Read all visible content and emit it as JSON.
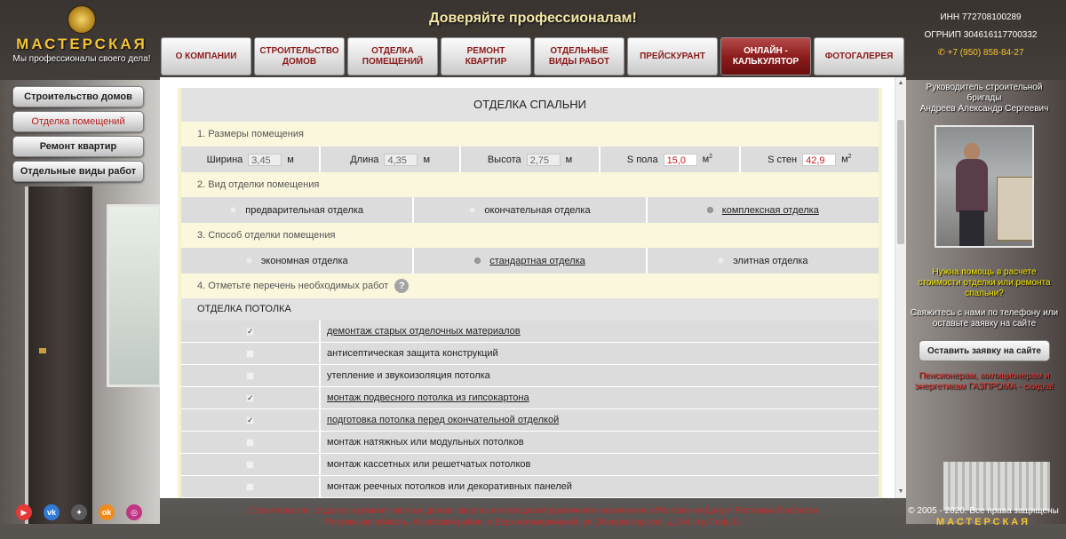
{
  "header": {
    "logo_title": "МАСТЕРСКАЯ",
    "logo_subtitle": "Мы профессионалы своего дела!",
    "slogan": "Доверяйте профессионалам!",
    "inn": "ИНН 772708100289",
    "ogrnip": "ОГРНИП 304616117700332",
    "phone": "+7 (950) 858-84-27",
    "phone_icon": "phone-icon"
  },
  "nav": {
    "items": [
      {
        "label": "О КОМПАНИИ",
        "active": false
      },
      {
        "label": "СТРОИТЕЛЬСТВО\nДОМОВ",
        "active": false
      },
      {
        "label": "ОТДЕЛКА\nПОМЕЩЕНИЙ",
        "active": false
      },
      {
        "label": "РЕМОНТ\nКВАРТИР",
        "active": false
      },
      {
        "label": "ОТДЕЛЬНЫЕ\nВИДЫ РАБОТ",
        "active": false
      },
      {
        "label": "ПРЕЙСКУРАНТ",
        "active": false
      },
      {
        "label": "ОНЛАЙН -\nКАЛЬКУЛЯТОР",
        "active": true
      },
      {
        "label": "ФОТОГАЛЕРЕЯ",
        "active": false
      }
    ]
  },
  "sidebar": {
    "items": [
      {
        "label": "Строительство домов",
        "active": false
      },
      {
        "label": "Отделка помещений",
        "active": true
      },
      {
        "label": "Ремонт квартир",
        "active": false
      },
      {
        "label": "Отдельные виды работ",
        "active": false
      }
    ]
  },
  "calc": {
    "title": "ОТДЕЛКА СПАЛЬНИ",
    "section1": "1. Размеры помещения",
    "dims": {
      "width_label": "Ширина",
      "width_value": "3,45",
      "width_unit": "м",
      "length_label": "Длина",
      "length_value": "4,35",
      "length_unit": "м",
      "height_label": "Высота",
      "height_value": "2,75",
      "height_unit": "м",
      "floor_label": "S пола",
      "floor_value": "15,0",
      "floor_unit": "м",
      "walls_label": "S стен",
      "walls_value": "42,9",
      "walls_unit": "м",
      "sup": "2"
    },
    "section2": "2. Вид отделки помещения",
    "finish_types": [
      {
        "label": "предварительная отделка",
        "selected": false
      },
      {
        "label": "окончательная отделка",
        "selected": false
      },
      {
        "label": "комплексная отделка",
        "selected": true
      }
    ],
    "section3": "3. Способ отделки помещения",
    "finish_methods": [
      {
        "label": "экономная отделка",
        "selected": false
      },
      {
        "label": "стандартная отделка",
        "selected": true
      },
      {
        "label": "элитная отделка",
        "selected": false
      }
    ],
    "section4": "4. Отметьте перечень необходимых работ",
    "help": "?",
    "ceiling_group": "ОТДЕЛКА ПОТОЛКА",
    "check_mark": "✓",
    "works": [
      {
        "label": "демонтаж старых отделочных материалов",
        "checked": true
      },
      {
        "label": "антисептическая защита конструкций",
        "checked": false
      },
      {
        "label": "утепление и звукоизоляция потолка",
        "checked": false
      },
      {
        "label": "монтаж подвесного потолка из гипсокартона",
        "checked": true
      },
      {
        "label": "подготовка потолка перед окончательной отделкой",
        "checked": true
      },
      {
        "label": "монтаж натяжных или модульных потолков",
        "checked": false
      },
      {
        "label": "монтаж кассетных или решетчатых потолков",
        "checked": false
      },
      {
        "label": "монтаж реечных потолков или декоративных панелей",
        "checked": false
      }
    ]
  },
  "right_panel": {
    "manager": "Руководитель строительной бригады\nАндреев Александр Сергеевич",
    "help_text": "Нужна помощь в расчете стоимости отделки или ремонта спальни?",
    "contact_text": "Свяжитесь с нами по телефону или оставьте заявку на сайте",
    "cta_label": "Оставить заявку на сайте",
    "promo": "Пенсионерам, милиционерам и энергетикам ГАЗПРОМА - скидка!"
  },
  "footer": {
    "line1": "Строительство, отделка и ремонт частных домов, квартир и помещений различного назначения в Ростове-на-Дону и Ростовской области",
    "line2": "Ростовская область, Аксайский район, п.Верхнетемерницкий, ул.Обсерваторская, д.104 стр.2 оф.31",
    "copyright": "© 2005 - 2020. Все права защищены",
    "brand": "МАСТЕРСКАЯ",
    "social": [
      {
        "icon": "youtube-icon",
        "glyph": "▶",
        "color": "#e53935"
      },
      {
        "icon": "vk-icon",
        "glyph": "vk",
        "color": "#2f7bd6"
      },
      {
        "icon": "sparkle-icon",
        "glyph": "✦",
        "color": "#5a5a5a"
      },
      {
        "icon": "odnoklassniki-icon",
        "glyph": "ok",
        "color": "#f08b1b"
      },
      {
        "icon": "instagram-icon",
        "glyph": "◎",
        "color": "#c13584"
      }
    ]
  }
}
